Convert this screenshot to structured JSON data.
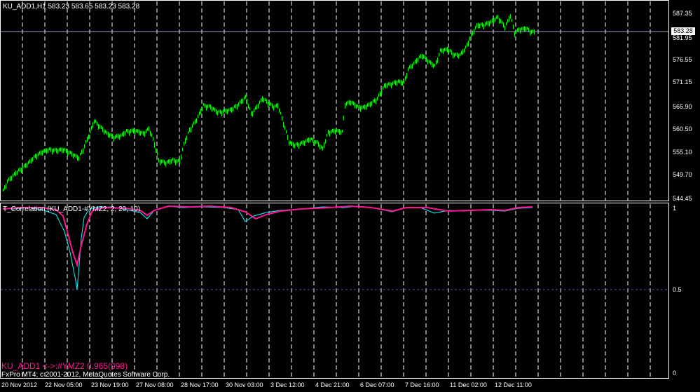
{
  "main_chart": {
    "title": "KU_ADD1,H1  583.23 583.65 583.23 583.28",
    "current_price": "583.28",
    "price_labels": [
      "587.35",
      "581.95",
      "576.55",
      "571.15",
      "565.90",
      "560.50",
      "555.10",
      "549.70",
      "544.45"
    ],
    "candle_color": "#00ff00",
    "current_line_color": "#a0a0c0"
  },
  "indicator": {
    "title": "T_Correlation (KU_ADD1-#YMZ2, 2, 20, 10)",
    "levels": [
      "1",
      "0.5",
      "0"
    ],
    "line1_color": "#00ffff",
    "line2_color": "#ff1493",
    "level_line_color": "#8040c0"
  },
  "status": {
    "correlation_text": "KU_ADD1 <->:#YMZ2   0.965(998)",
    "copyright": "FxPro MT4; c 2001-2012, MetaQuotes Software Corp."
  },
  "time_axis": [
    "20 Nov 2012",
    "22 Nov 05:00",
    "23 Nov 19:00",
    "27 Nov 08:00",
    "28 Nov 17:00",
    "30 Nov 03:00",
    "3 Dec 12:00",
    "4 Dec 21:00",
    "6 Dec 07:00",
    "7 Dec 16:00",
    "11 Dec 02:00",
    "12 Dec 11:00"
  ]
}
